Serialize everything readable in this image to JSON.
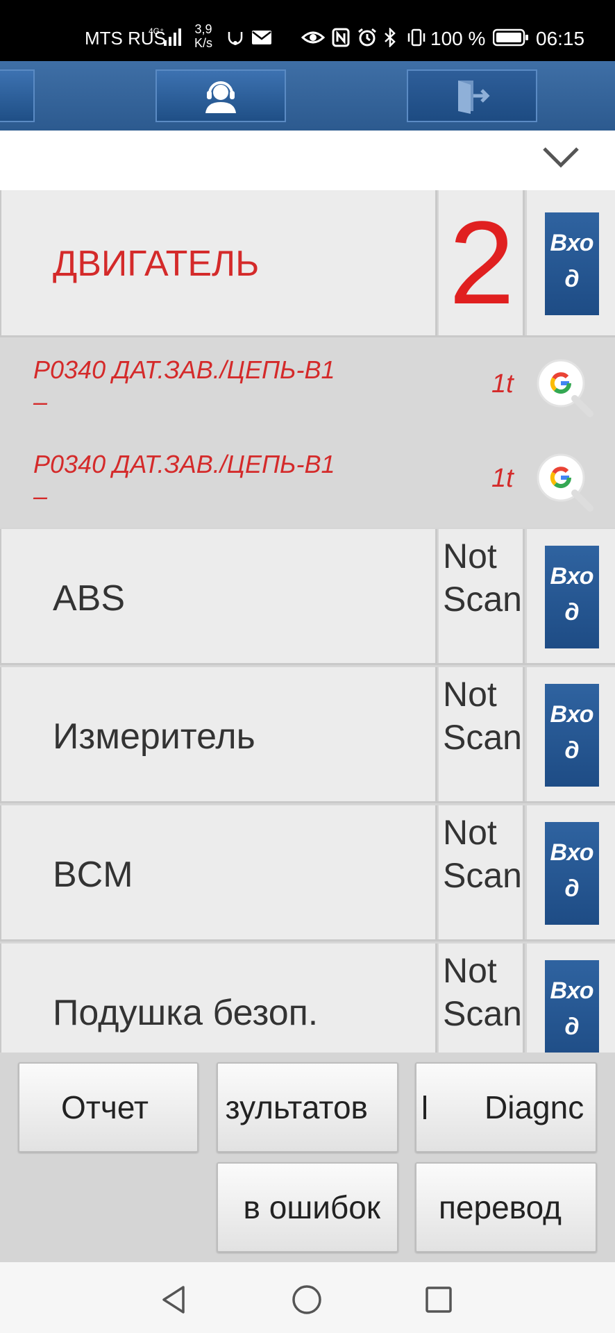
{
  "status_bar": {
    "carrier": "MTS RUS",
    "network": "4G⁺",
    "speed_value": "3,9",
    "speed_unit": "K/s",
    "battery_percent": "100 %",
    "time": "06:15"
  },
  "toolbar": {
    "user_icon": "operator-headset-icon",
    "exit_icon": "exit-door-icon"
  },
  "dropdown": {
    "icon": "chevron-down-icon"
  },
  "engine_row": {
    "name": "ДВИГАТЕЛЬ",
    "count": "2",
    "enter_label_1": "Вхо",
    "enter_label_2": "д"
  },
  "dtc_list": [
    {
      "code_line1": "P0340 ДАТ.ЗАВ./ЦЕПЬ-B1",
      "code_line2": "–",
      "count": "1t",
      "icon": "google-search-icon"
    },
    {
      "code_line1": "P0340 ДАТ.ЗАВ./ЦЕПЬ-B1",
      "code_line2": "–",
      "count": "1t",
      "icon": "google-search-icon"
    }
  ],
  "systems": [
    {
      "name": "ABS",
      "status": "Not Scanned",
      "enter_1": "Вхо",
      "enter_2": "д"
    },
    {
      "name": "Измеритель",
      "status": "Not Scanned",
      "enter_1": "Вхо",
      "enter_2": "д"
    },
    {
      "name": "BCM",
      "status": "Not Scanned",
      "enter_1": "Вхо",
      "enter_2": "д"
    },
    {
      "name": "Подушка безоп.",
      "status": "Not Scanned",
      "enter_1": "Вхо",
      "enter_2": "д"
    }
  ],
  "actions": {
    "report": "Отчет",
    "results": "зультатов",
    "diagnostics": "Diagnc",
    "errors": "в ошибок",
    "translate": "перевод"
  },
  "colors": {
    "toolbar_blue": "#2c5a8f",
    "enter_button_blue": "#1e4c85",
    "error_red": "#d42a2a"
  }
}
